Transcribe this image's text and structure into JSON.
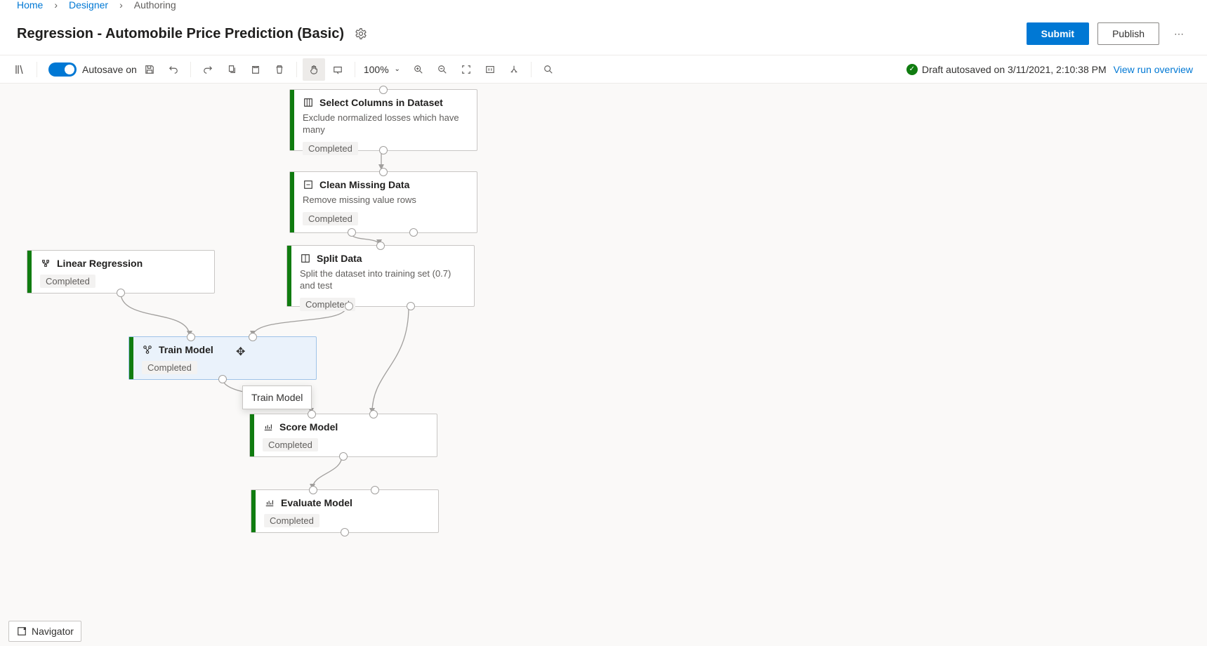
{
  "breadcrumb": {
    "home": "Home",
    "designer": "Designer",
    "authoring": "Authoring"
  },
  "title": "Regression - Automobile Price Prediction (Basic)",
  "buttons": {
    "submit": "Submit",
    "publish": "Publish"
  },
  "toolbar": {
    "autosave_label": "Autosave on",
    "zoom": "100%"
  },
  "status": {
    "text": "Draft autosaved on 3/11/2021, 2:10:38 PM",
    "link": "View run overview"
  },
  "nodes": {
    "selectCols": {
      "title": "Select Columns in Dataset",
      "desc": "Exclude normalized losses which have many",
      "status": "Completed"
    },
    "clean": {
      "title": "Clean Missing Data",
      "desc": "Remove missing value rows",
      "status": "Completed"
    },
    "split": {
      "title": "Split Data",
      "desc": "Split the dataset into training set (0.7) and test",
      "status": "Completed"
    },
    "linreg": {
      "title": "Linear Regression",
      "status": "Completed"
    },
    "train": {
      "title": "Train Model",
      "status": "Completed"
    },
    "score": {
      "title": "Score Model",
      "status": "Completed"
    },
    "evaluate": {
      "title": "Evaluate Model",
      "status": "Completed"
    }
  },
  "tooltip": {
    "trainModel": "Train Model"
  },
  "navigator": {
    "label": "Navigator"
  }
}
